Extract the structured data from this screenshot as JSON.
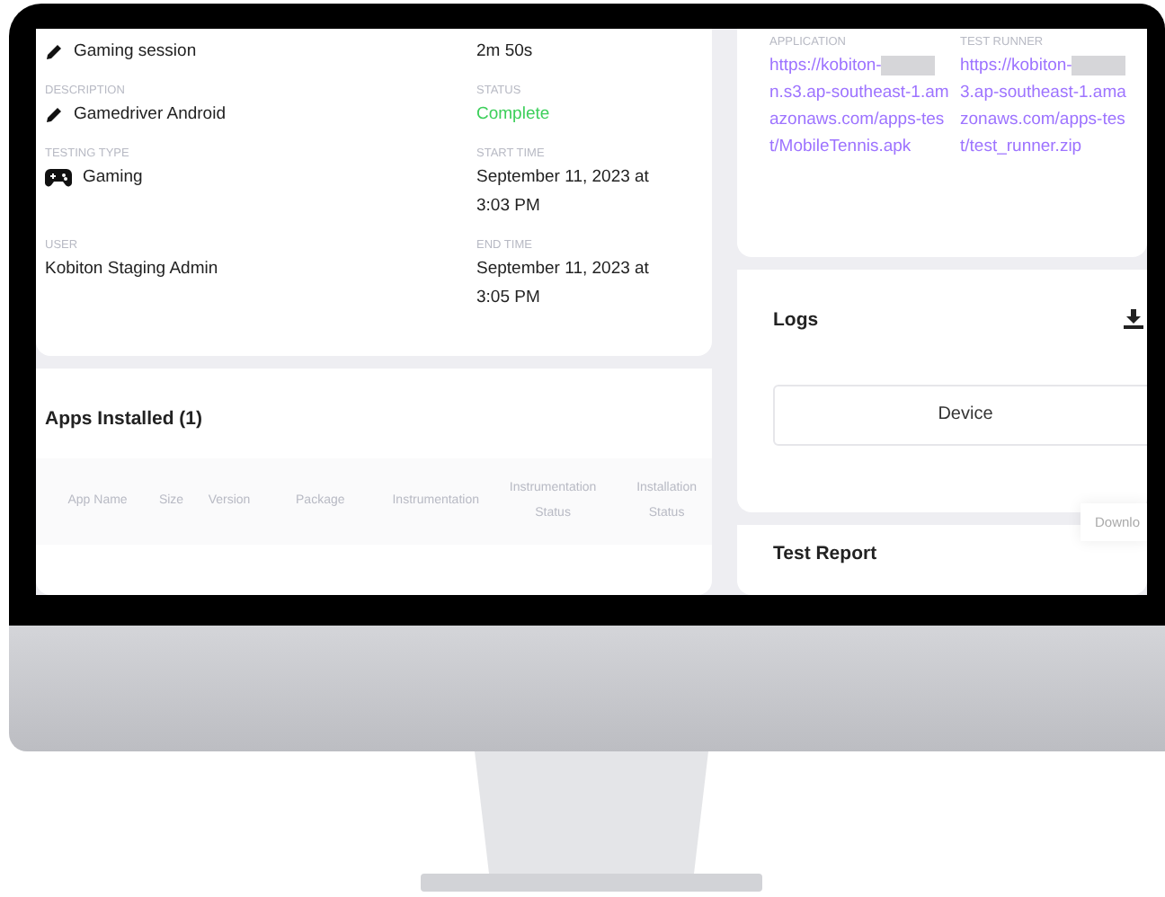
{
  "session_details": {
    "left": [
      {
        "value": "Gaming session"
      },
      {
        "label": "DESCRIPTION",
        "value": "Gamedriver Android"
      },
      {
        "label": "TESTING TYPE",
        "value": "Gaming"
      },
      {
        "label": "USER",
        "value": "Kobiton Staging Admin"
      }
    ],
    "right": [
      {
        "kind": "text",
        "value": "2m 50s"
      },
      {
        "kind": "status",
        "label": "STATUS",
        "value": "Complete"
      },
      {
        "kind": "text",
        "label": "START TIME",
        "value": "September 11, 2023 at 3:03 PM"
      },
      {
        "kind": "text",
        "label": "END TIME",
        "value": "September 11, 2023 at 3:05 PM"
      }
    ]
  },
  "apps_installed": {
    "title": "Apps Installed (1)",
    "columns": [
      "App Name",
      "Size",
      "Version",
      "Package",
      "Instrumentation",
      "Instrumentation Status",
      "Installation Status"
    ]
  },
  "files": [
    {
      "label": "APPLICATION",
      "url_start": "https://kobiton-",
      "url_end": "n.s3.ap-southeast-1.amazonaws.com/apps-test/MobileTennis.apk"
    },
    {
      "label": "TEST RUNNER",
      "url_start": "https://kobiton-",
      "url_end": "3.ap-southeast-1.amazonaws.com/apps-test/test_runner.zip"
    }
  ],
  "logs": {
    "title": "Logs",
    "button": "Device"
  },
  "test_report": {
    "title": "Test Report",
    "tooltip": "Downlo"
  }
}
